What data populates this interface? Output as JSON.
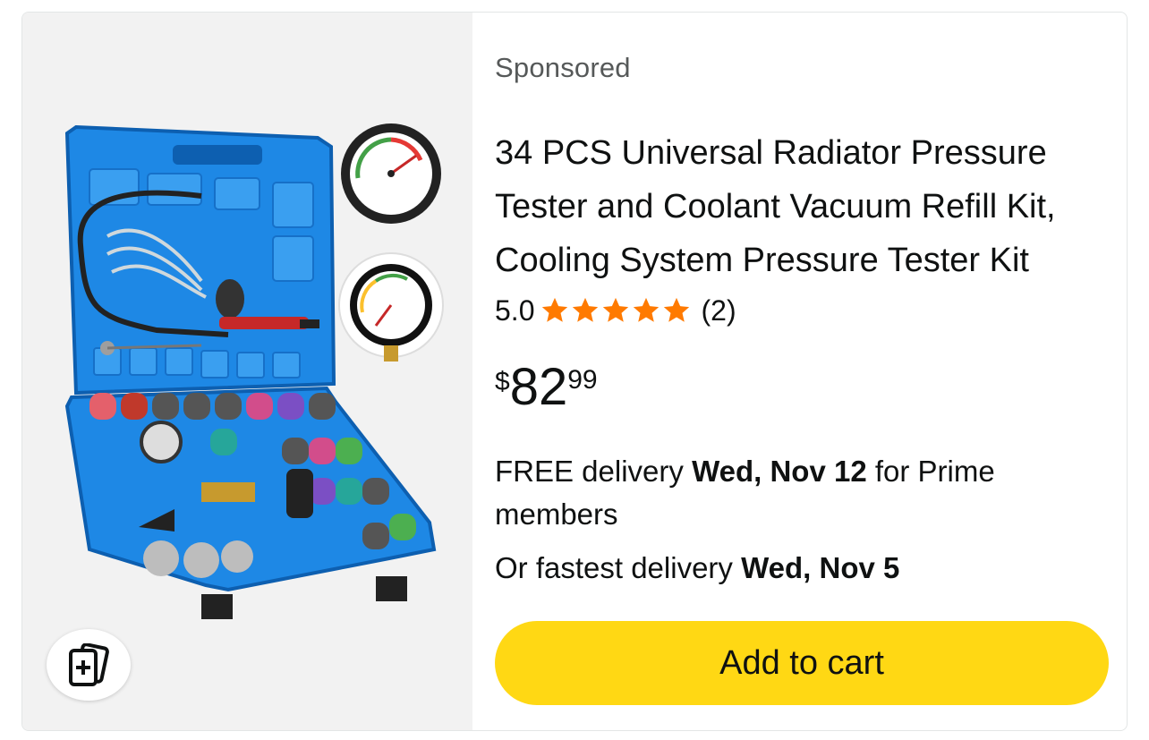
{
  "sponsored_label": "Sponsored",
  "product": {
    "title": "34 PCS Universal Radiator Pressure Tester and Coolant Vacuum Refill Kit, Cooling System Pressure Tester Kit",
    "rating": "5.0",
    "stars_filled": 5,
    "stars_total": 5,
    "review_count": "(2)",
    "price": {
      "symbol": "$",
      "whole": "82",
      "fraction": "99"
    },
    "delivery": {
      "free_prefix": "FREE delivery",
      "free_date": "Wed, Nov 12",
      "free_suffix": "for Prime members",
      "fastest_prefix": "Or fastest delivery",
      "fastest_date": "Wed, Nov 5"
    }
  },
  "add_to_cart_label": "Add to cart",
  "colors": {
    "star": "#ff7a00",
    "button": "#ffd814",
    "case_blue": "#1e88e5",
    "muted_text": "#565959"
  },
  "icons": {
    "compare": "compare-cards-icon",
    "star": "star-icon"
  }
}
